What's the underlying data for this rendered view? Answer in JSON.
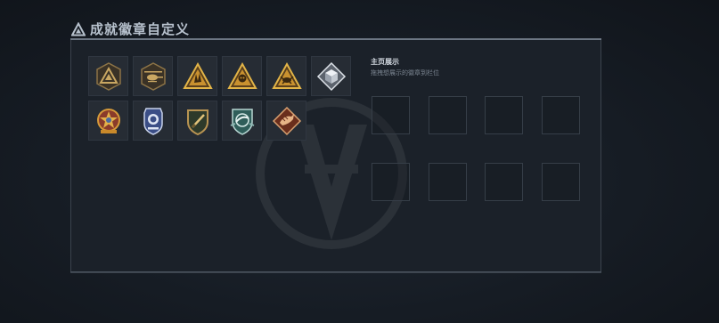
{
  "header": {
    "title": "成就徽章自定义",
    "icon": "triangle-warning-icon"
  },
  "badges": [
    {
      "name": "badge-triangle-bronze",
      "icon": "triangle-emblem-icon",
      "color": "#b89352"
    },
    {
      "name": "badge-helicopter",
      "icon": "helicopter-emblem-icon",
      "color": "#b89352"
    },
    {
      "name": "badge-hand-gold",
      "icon": "hand-triangle-icon",
      "color": "#d4a53c"
    },
    {
      "name": "badge-skull-gold",
      "icon": "skull-triangle-icon",
      "color": "#d4a53c"
    },
    {
      "name": "badge-crab-gold",
      "icon": "crab-triangle-icon",
      "color": "#d4a53c"
    },
    {
      "name": "badge-cube-silver",
      "icon": "cube-diamond-icon",
      "color": "#c9ced6"
    },
    {
      "name": "badge-star-medal",
      "icon": "star-medal-icon",
      "color": "#c9892a"
    },
    {
      "name": "badge-police-shield",
      "icon": "police-shield-icon",
      "color": "#5a73b0"
    },
    {
      "name": "badge-blade-shield",
      "icon": "blade-shield-icon",
      "color": "#b89352"
    },
    {
      "name": "badge-wing-shield",
      "icon": "wing-shield-icon",
      "color": "#4f8a86"
    },
    {
      "name": "badge-dragon-diamond",
      "icon": "dragon-diamond-icon",
      "color": "#b5603a"
    }
  ],
  "display": {
    "title": "主页展示",
    "subtitle": "拖拽想展示的徽章到栏位"
  },
  "colors": {
    "panel": "#1b2129",
    "accent": "#6c7683"
  }
}
